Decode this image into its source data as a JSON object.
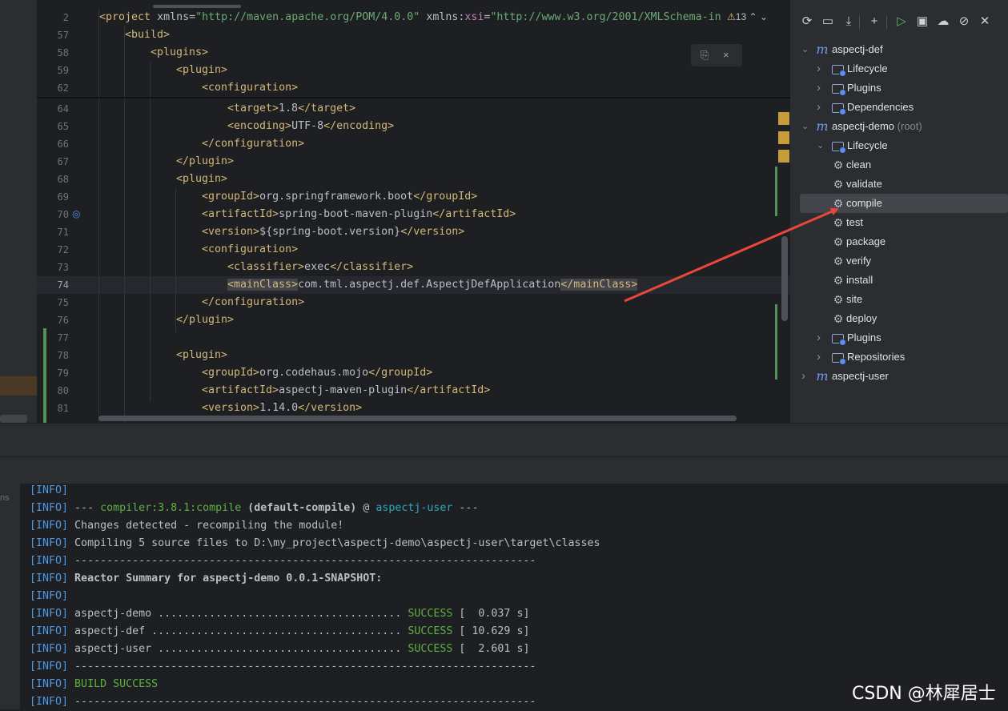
{
  "editor": {
    "warning_count": "13",
    "lines": [
      {
        "n": "2",
        "indent": 0,
        "parts": [
          [
            "tag",
            "<project "
          ],
          [
            "attr",
            "xmlns="
          ],
          [
            "attrv",
            "\"http://maven.apache.org/POM/4.0.0\""
          ],
          [
            "attr",
            " xmlns:"
          ],
          [
            "ns",
            "xsi"
          ],
          [
            "attr",
            "="
          ],
          [
            "attrv",
            "\"http://www.w3.org/2001/XMLSchema-in"
          ]
        ]
      },
      {
        "n": "57",
        "indent": 1,
        "parts": [
          [
            "tag",
            "<build>"
          ]
        ]
      },
      {
        "n": "58",
        "indent": 2,
        "parts": [
          [
            "tag",
            "<plugins>"
          ]
        ]
      },
      {
        "n": "59",
        "indent": 3,
        "parts": [
          [
            "tag",
            "<plugin>"
          ]
        ]
      },
      {
        "n": "62",
        "indent": 4,
        "parts": [
          [
            "tag",
            "<configuration>"
          ]
        ]
      },
      {
        "n": "64",
        "indent": 5,
        "parts": [
          [
            "tag",
            "<target>"
          ],
          [
            "attr",
            "1.8"
          ],
          [
            "tag",
            "</target>"
          ]
        ]
      },
      {
        "n": "65",
        "indent": 5,
        "parts": [
          [
            "tag",
            "<encoding>"
          ],
          [
            "attr",
            "UTF-8"
          ],
          [
            "tag",
            "</encoding>"
          ]
        ]
      },
      {
        "n": "66",
        "indent": 4,
        "parts": [
          [
            "tag",
            "</configuration>"
          ]
        ]
      },
      {
        "n": "67",
        "indent": 3,
        "parts": [
          [
            "tag",
            "</plugin>"
          ]
        ]
      },
      {
        "n": "68",
        "indent": 3,
        "parts": [
          [
            "tag",
            "<plugin>"
          ]
        ]
      },
      {
        "n": "69",
        "indent": 4,
        "parts": [
          [
            "tag",
            "<groupId>"
          ],
          [
            "attr",
            "org.springframework.boot"
          ],
          [
            "tag",
            "</groupId>"
          ]
        ]
      },
      {
        "n": "70",
        "indent": 4,
        "parts": [
          [
            "tag",
            "<artifactId>"
          ],
          [
            "attr",
            "spring-boot-maven-plugin"
          ],
          [
            "tag",
            "</artifactId>"
          ]
        ]
      },
      {
        "n": "71",
        "indent": 4,
        "parts": [
          [
            "tag",
            "<version>"
          ],
          [
            "attr",
            "${spring-boot.version}"
          ],
          [
            "tag",
            "</version>"
          ]
        ]
      },
      {
        "n": "72",
        "indent": 4,
        "parts": [
          [
            "tag",
            "<configuration>"
          ]
        ]
      },
      {
        "n": "73",
        "indent": 5,
        "parts": [
          [
            "tag",
            "<classifier>"
          ],
          [
            "attr",
            "exec"
          ],
          [
            "tag",
            "</classifier>"
          ]
        ]
      },
      {
        "n": "74",
        "indent": 5,
        "cur": true,
        "parts": [
          [
            "tagh",
            "<mainClass>"
          ],
          [
            "attr",
            "com.tml.aspectj.def.AspectjDefApplication"
          ],
          [
            "tagh",
            "</mainClass>"
          ]
        ]
      },
      {
        "n": "75",
        "indent": 4,
        "parts": [
          [
            "tag",
            "</configuration>"
          ]
        ]
      },
      {
        "n": "76",
        "indent": 3,
        "parts": [
          [
            "tag",
            "</plugin>"
          ]
        ]
      },
      {
        "n": "77",
        "indent": 0,
        "parts": []
      },
      {
        "n": "78",
        "indent": 3,
        "parts": [
          [
            "tag",
            "<plugin>"
          ]
        ]
      },
      {
        "n": "79",
        "indent": 4,
        "parts": [
          [
            "tag",
            "<groupId>"
          ],
          [
            "attr",
            "org.codehaus.mojo"
          ],
          [
            "tag",
            "</groupId>"
          ]
        ]
      },
      {
        "n": "80",
        "indent": 4,
        "parts": [
          [
            "tag",
            "<artifactId>"
          ],
          [
            "attr",
            "aspectj-maven-plugin"
          ],
          [
            "tag",
            "</artifactId>"
          ]
        ]
      },
      {
        "n": "81",
        "indent": 4,
        "parts": [
          [
            "tag",
            "<version>"
          ],
          [
            "attr",
            "1.14.0"
          ],
          [
            "tag",
            "</version>"
          ]
        ]
      }
    ]
  },
  "maven": {
    "toolbar": [
      "reload-icon",
      "add-folder-icon",
      "download-icon",
      "plus-icon",
      "run-icon",
      "execute-goal-icon",
      "offline-icon",
      "skip-tests-icon",
      "collapse-icon"
    ],
    "tree": [
      {
        "id": "aspectj-def",
        "label": "aspectj-def",
        "depth": 0,
        "chev": "v",
        "icon": "m"
      },
      {
        "id": "def-lifecycle",
        "label": "Lifecycle",
        "depth": 1,
        "chev": ">",
        "icon": "folder"
      },
      {
        "id": "def-plugins",
        "label": "Plugins",
        "depth": 1,
        "chev": ">",
        "icon": "folder"
      },
      {
        "id": "def-dependencies",
        "label": "Dependencies",
        "depth": 1,
        "chev": ">",
        "icon": "folder"
      },
      {
        "id": "aspectj-demo",
        "label": "aspectj-demo",
        "suffix": "(root)",
        "depth": 0,
        "chev": "v",
        "icon": "m"
      },
      {
        "id": "demo-lifecycle",
        "label": "Lifecycle",
        "depth": 1,
        "chev": "v",
        "icon": "folder"
      },
      {
        "id": "clean",
        "label": "clean",
        "depth": 2,
        "icon": "gear"
      },
      {
        "id": "validate",
        "label": "validate",
        "depth": 2,
        "icon": "gear"
      },
      {
        "id": "compile",
        "label": "compile",
        "depth": 2,
        "icon": "gear",
        "selected": true
      },
      {
        "id": "test",
        "label": "test",
        "depth": 2,
        "icon": "gear"
      },
      {
        "id": "package",
        "label": "package",
        "depth": 2,
        "icon": "gear"
      },
      {
        "id": "verify",
        "label": "verify",
        "depth": 2,
        "icon": "gear"
      },
      {
        "id": "install",
        "label": "install",
        "depth": 2,
        "icon": "gear"
      },
      {
        "id": "site",
        "label": "site",
        "depth": 2,
        "icon": "gear"
      },
      {
        "id": "deploy",
        "label": "deploy",
        "depth": 2,
        "icon": "gear"
      },
      {
        "id": "demo-plugins",
        "label": "Plugins",
        "depth": 1,
        "chev": ">",
        "icon": "folder"
      },
      {
        "id": "demo-repositories",
        "label": "Repositories",
        "depth": 1,
        "chev": ">",
        "icon": "folder"
      },
      {
        "id": "aspectj-user",
        "label": "aspectj-user",
        "depth": 0,
        "chev": ">",
        "icon": "m"
      }
    ]
  },
  "console": {
    "side_label": "ns",
    "lines": [
      [
        [
          "bl",
          "[INFO]"
        ]
      ],
      [
        [
          "bl",
          "[INFO]"
        ],
        [
          "n",
          " --- "
        ],
        [
          "gr",
          "compiler:3.8.1:compile"
        ],
        [
          "n",
          " "
        ],
        [
          "b",
          "(default-compile)"
        ],
        [
          "n",
          " @ "
        ],
        [
          "cy",
          "aspectj-user"
        ],
        [
          "n",
          " ---"
        ]
      ],
      [
        [
          "bl",
          "[INFO]"
        ],
        [
          "n",
          " Changes detected - recompiling the module!"
        ]
      ],
      [
        [
          "bl",
          "[INFO]"
        ],
        [
          "n",
          " Compiling 5 source files to D:\\my_project\\aspectj-demo\\aspectj-user\\target\\classes"
        ]
      ],
      [
        [
          "bl",
          "[INFO]"
        ],
        [
          "n",
          " ------------------------------------------------------------------------"
        ]
      ],
      [
        [
          "bl",
          "[INFO]"
        ],
        [
          "b",
          " Reactor Summary for aspectj-demo 0.0.1-SNAPSHOT:"
        ]
      ],
      [
        [
          "bl",
          "[INFO]"
        ]
      ],
      [
        [
          "bl",
          "[INFO]"
        ],
        [
          "n",
          " aspectj-demo ...................................... "
        ],
        [
          "gr",
          "SUCCESS"
        ],
        [
          "n",
          " [  0.037 s]"
        ]
      ],
      [
        [
          "bl",
          "[INFO]"
        ],
        [
          "n",
          " aspectj-def ....................................... "
        ],
        [
          "gr",
          "SUCCESS"
        ],
        [
          "n",
          " [ 10.629 s]"
        ]
      ],
      [
        [
          "bl",
          "[INFO]"
        ],
        [
          "n",
          " aspectj-user ...................................... "
        ],
        [
          "gr",
          "SUCCESS"
        ],
        [
          "n",
          " [  2.601 s]"
        ]
      ],
      [
        [
          "bl",
          "[INFO]"
        ],
        [
          "n",
          " ------------------------------------------------------------------------"
        ]
      ],
      [
        [
          "bl",
          "[INFO]"
        ],
        [
          "gr",
          " BUILD SUCCESS"
        ]
      ],
      [
        [
          "bl",
          "[INFO]"
        ],
        [
          "n",
          " ------------------------------------------------------------------------"
        ]
      ]
    ]
  },
  "watermark": "CSDN @林犀居士",
  "colors": {
    "annotation_arrow": "#e8473b",
    "accent": "#c69b3a"
  }
}
